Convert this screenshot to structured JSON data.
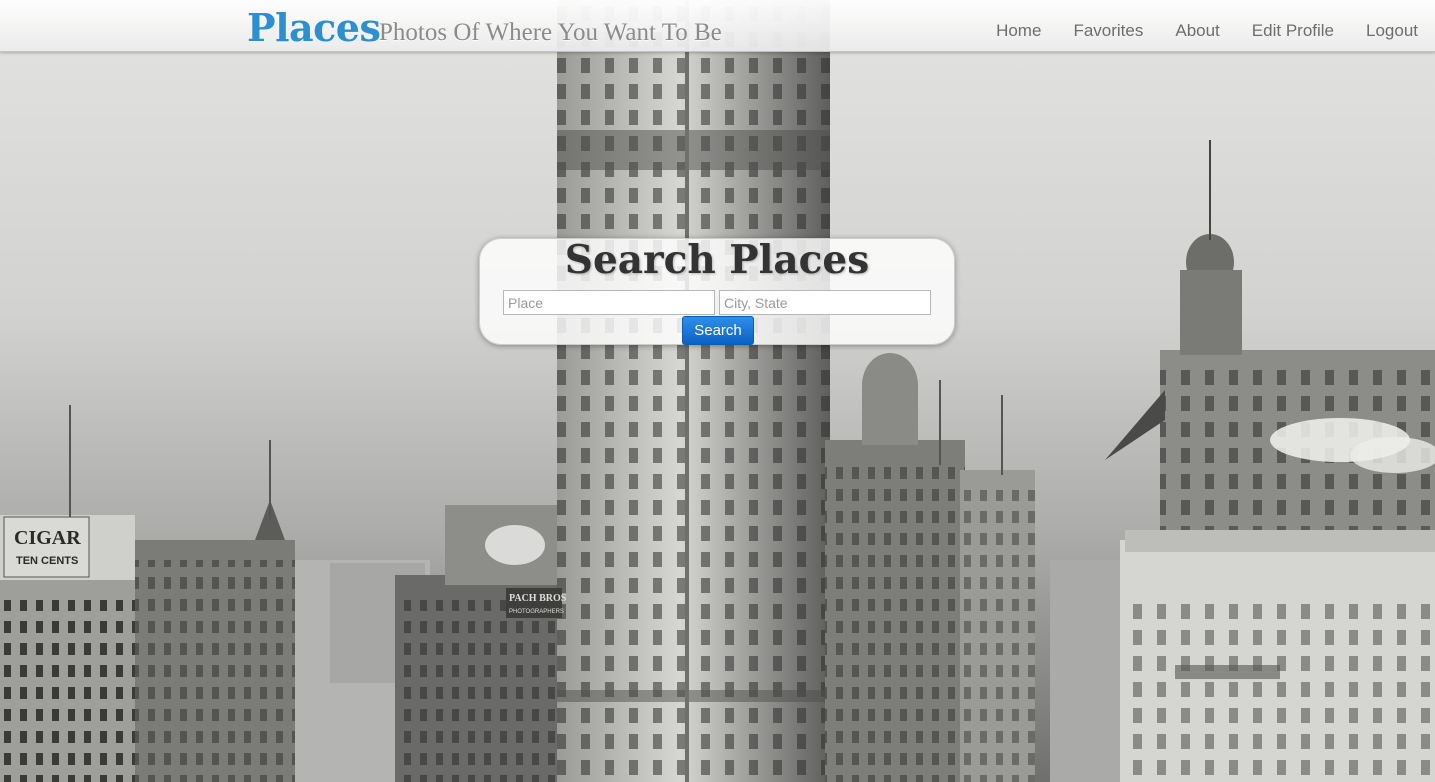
{
  "header": {
    "brand": "Places",
    "tagline": "Photos Of Where You Want To Be",
    "nav": [
      {
        "label": "Home"
      },
      {
        "label": "Favorites"
      },
      {
        "label": "About"
      },
      {
        "label": "Edit Profile"
      },
      {
        "label": "Logout"
      }
    ]
  },
  "search": {
    "title": "Search Places",
    "place_placeholder": "Place",
    "place_value": "",
    "city_placeholder": "City, State",
    "city_value": "",
    "button_label": "Search"
  },
  "background": {
    "sign_cigar": "CIGAR",
    "sign_cents": "TEN CENTS",
    "sign_bros": "PACH BROS",
    "sign_photographers": "PHOTOGRAPHERS"
  },
  "colors": {
    "brand": "#2b8fd0",
    "button": "#0a62c4"
  }
}
